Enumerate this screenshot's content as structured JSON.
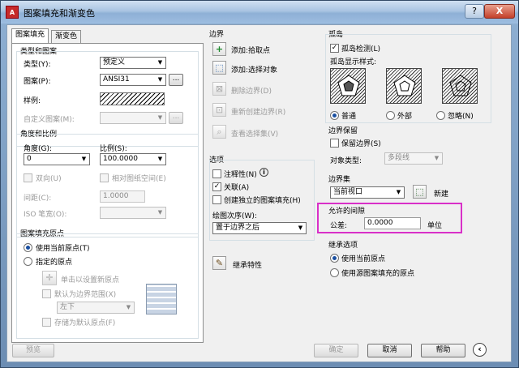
{
  "window": {
    "title": "图案填充和渐变色",
    "app_icon": "A",
    "help_glyph": "?",
    "close_glyph": "X"
  },
  "tabs": {
    "hatch": "图案填充",
    "gradient": "渐变色"
  },
  "type_pattern": {
    "heading": "类型和图案",
    "type_label": "类型(Y):",
    "type_value": "预定义",
    "pattern_label": "图案(P):",
    "pattern_value": "ANSI31",
    "swatch_label": "样例:",
    "custom_label": "自定义图案(M):",
    "browse": "..."
  },
  "angle_scale": {
    "heading": "角度和比例",
    "angle_label": "角度(G):",
    "angle_value": "0",
    "scale_label": "比例(S):",
    "scale_value": "100.0000",
    "double_label": "双向(U)",
    "relative_label": "相对图纸空间(E)",
    "spacing_label": "间距(C):",
    "spacing_value": "1.0000",
    "iso_label": "ISO 笔宽(O):"
  },
  "origin": {
    "heading": "图案填充原点",
    "current": "使用当前原点(T)",
    "specified": "指定的原点",
    "click_set": "单击以设置新原点",
    "default_extents": "默认为边界范围(X)",
    "position": "左下",
    "store_default": "存储为默认原点(F)"
  },
  "boundaries": {
    "heading": "边界",
    "add_pick": "添加:拾取点",
    "add_select": "添加:选择对象",
    "remove": "删除边界(D)",
    "recreate": "重新创建边界(R)",
    "view": "查看选择集(V)"
  },
  "options": {
    "heading": "选项",
    "annotative": "注释性(N)",
    "associative": "关联(A)",
    "separate": "创建独立的图案填充(H)",
    "draw_order_label": "绘图次序(W):",
    "draw_order_value": "置于边界之后"
  },
  "inherit": {
    "label": "继承特性"
  },
  "islands": {
    "heading": "孤岛",
    "detect": "孤岛检测(L)",
    "style_label": "孤岛显示样式:",
    "normal": "普通",
    "outer": "外部",
    "ignore": "忽略(N)"
  },
  "retain": {
    "heading": "边界保留",
    "retain_label": "保留边界(S)",
    "object_type_label": "对象类型:",
    "object_type_value": "多段线"
  },
  "boundary_set": {
    "heading": "边界集",
    "value": "当前视口",
    "new_label": "新建"
  },
  "gap": {
    "heading": "允许的间隙",
    "tolerance_label": "公差:",
    "tolerance_value": "0.0000",
    "units": "单位"
  },
  "inherit_options": {
    "heading": "继承选项",
    "use_current": "使用当前原点",
    "use_source": "使用源图案填充的原点"
  },
  "footer": {
    "preview": "预览",
    "ok": "确定",
    "cancel": "取消",
    "help": "帮助",
    "expand_glyph": "‹"
  },
  "colors": {
    "highlight": "#d930c8",
    "accent": "#1a4fa0"
  }
}
